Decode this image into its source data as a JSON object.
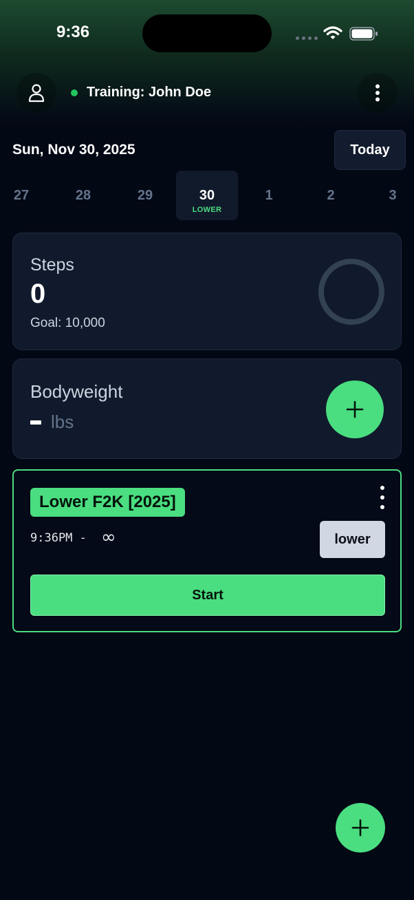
{
  "status_bar": {
    "time": "9:36"
  },
  "header": {
    "training_label": "Training: John Doe",
    "profile_icon": "person-icon",
    "menu_icon": "kebab-menu-icon"
  },
  "date_row": {
    "date_label": "Sun, Nov 30, 2025",
    "today_label": "Today"
  },
  "days": [
    {
      "num": "27",
      "tag": ""
    },
    {
      "num": "28",
      "tag": ""
    },
    {
      "num": "29",
      "tag": ""
    },
    {
      "num": "30",
      "tag": "LOWER",
      "selected": true
    },
    {
      "num": "1",
      "tag": ""
    },
    {
      "num": "2",
      "tag": ""
    },
    {
      "num": "3",
      "tag": ""
    }
  ],
  "steps": {
    "title": "Steps",
    "value": "0",
    "goal": "Goal: 10,000",
    "progress": 0
  },
  "bodyweight": {
    "title": "Bodyweight",
    "unit": "lbs",
    "add_icon": "plus-icon"
  },
  "workout": {
    "title": "Lower F2K [2025]",
    "time": "9:36PM -",
    "end": "∞",
    "tag": "lower",
    "start_label": "Start"
  },
  "colors": {
    "accent": "#4ade80",
    "background": "#030815",
    "card": "#111a2c"
  }
}
